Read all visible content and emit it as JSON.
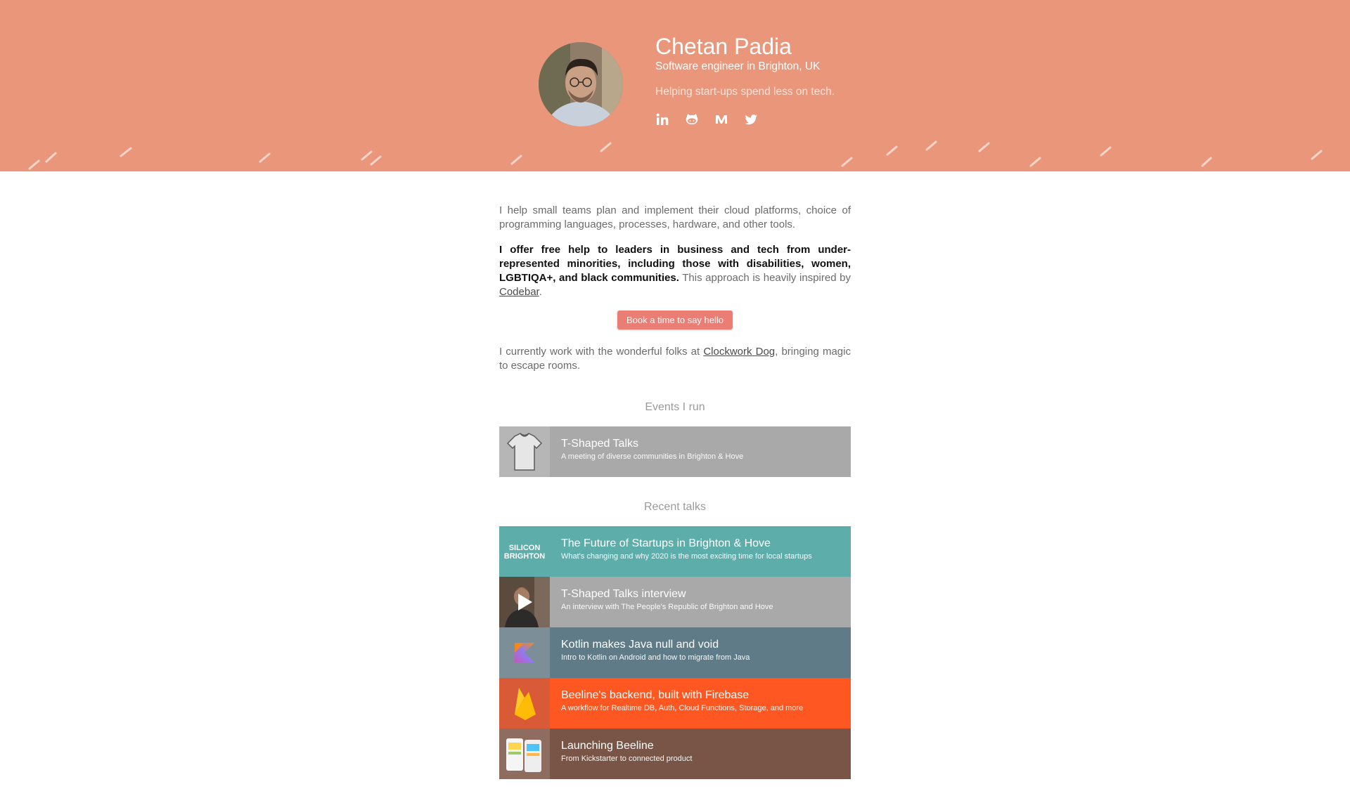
{
  "header": {
    "name": "Chetan Padia",
    "subtitle": "Software engineer in Brighton, UK",
    "tagline": "Helping start-ups spend less on tech.",
    "avatar_alt": "Chetan Padia",
    "socials": [
      {
        "icon": "linkedin-icon"
      },
      {
        "icon": "github-icon"
      },
      {
        "icon": "medium-icon"
      },
      {
        "icon": "twitter-icon"
      }
    ],
    "background_color": "#ea967b"
  },
  "intro": {
    "paragraph1": "I help small teams plan and implement their cloud platforms, choice of programming languages, processes, hardware, and other tools.",
    "paragraph2_bold": "I offer free help to leaders in business and tech from under-represented minorities, including those with disabilities, women, LGBTIQA+, and black communities.",
    "paragraph2_rest": " This approach is heavily inspired by ",
    "paragraph2_link": "Codebar",
    "paragraph2_end": ".",
    "cta_label": "Book a time to say hello",
    "paragraph3_start": "I currently work with the wonderful folks at ",
    "paragraph3_link": "Clockwork Dog",
    "paragraph3_end": ", bringing magic to escape rooms."
  },
  "events": {
    "heading": "Events I run",
    "items": [
      {
        "title": "T-Shaped Talks",
        "desc": "A meeting of diverse communities in Brighton & Hove",
        "color": "#a9a9a9"
      }
    ]
  },
  "talks": {
    "heading": "Recent talks",
    "items": [
      {
        "title": "The Future of Startups in Brighton & Hove",
        "desc": "What's changing and why 2020 is the most exciting time for local startups",
        "color": "#5dadab",
        "thumb_label_1": "SILICON",
        "thumb_label_2": "BRIGHTON"
      },
      {
        "title": "T-Shaped Talks interview",
        "desc": "An interview with The People's Republic of Brighton and Hove",
        "color": "#a9a9a9"
      },
      {
        "title": "Kotlin makes Java null and void",
        "desc": "Intro to Kotlin on Android and how to migrate from Java",
        "color": "#5f7b88"
      },
      {
        "title": "Beeline's backend, built with Firebase",
        "desc": "A workflow for Realtime DB, Auth, Cloud Functions, Storage, and more",
        "color": "#ff5722"
      },
      {
        "title": "Launching Beeline",
        "desc": "From Kickstarter to connected product",
        "color": "#795548"
      }
    ]
  }
}
